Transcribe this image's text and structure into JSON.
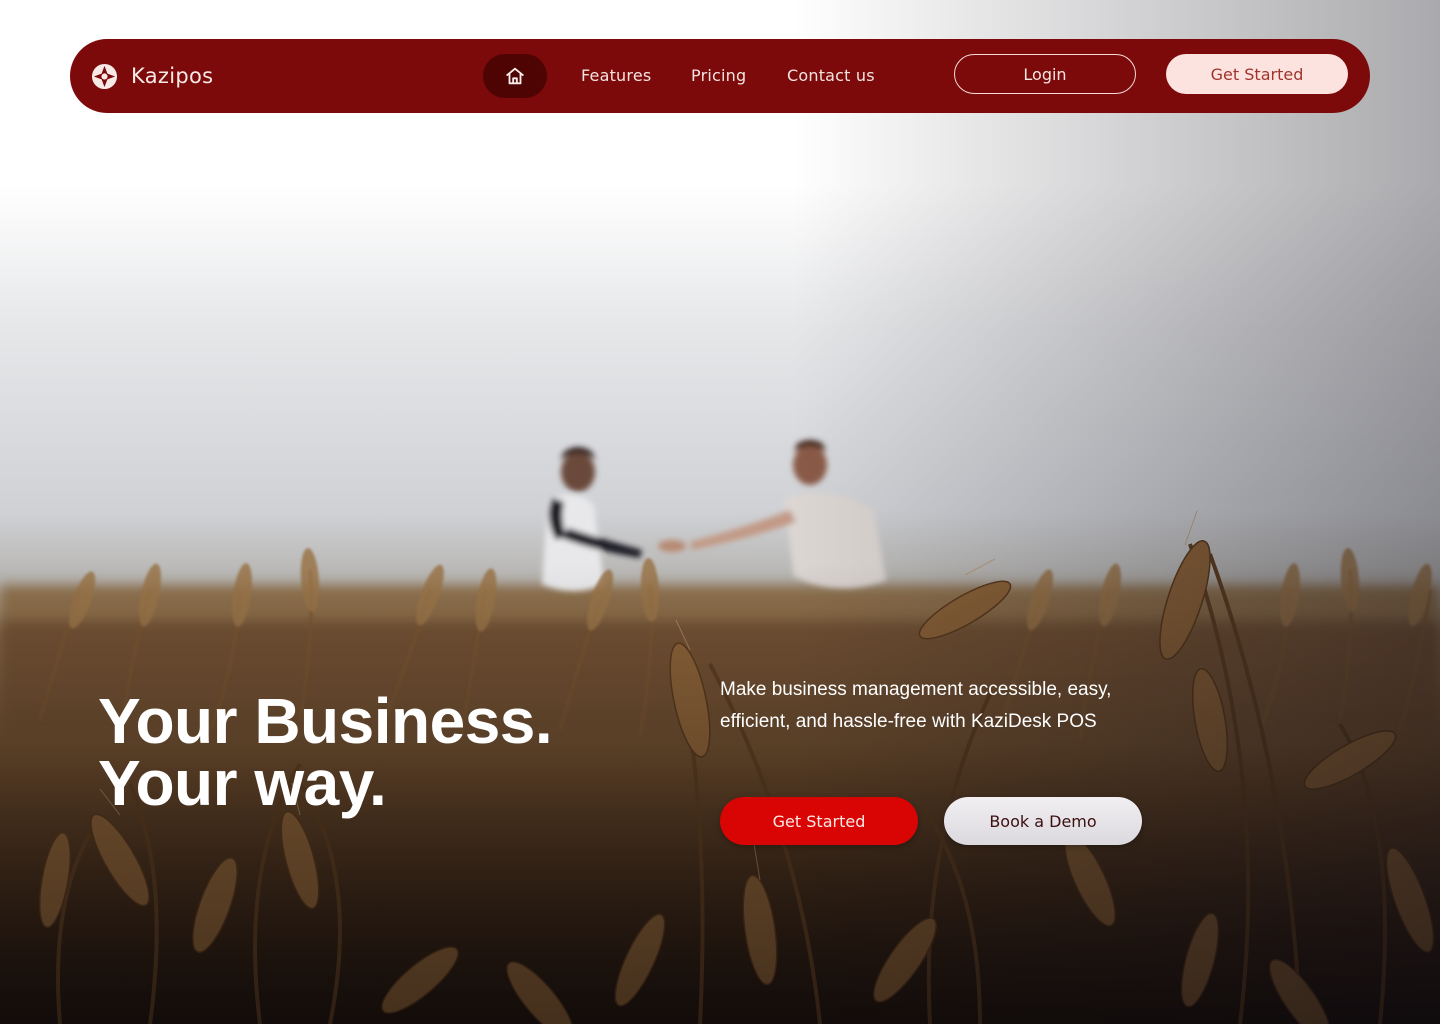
{
  "brand": {
    "name": "Kazipos",
    "icon": "compass-star-icon"
  },
  "nav": {
    "home_icon": "home-icon",
    "links": [
      "Features",
      "Pricing",
      "Contact us"
    ],
    "login_label": "Login",
    "get_started_label": "Get Started"
  },
  "hero": {
    "headline_line1": "Your Business.",
    "headline_line2": "Your way.",
    "subtext": "Make business management accessible, easy, efficient, and hassle-free with KaziDesk POS",
    "primary_cta": "Get Started",
    "secondary_cta": "Book a Demo",
    "image_description": "Two people shaking hands in a wheat field"
  },
  "colors": {
    "nav_bg": "#7d0a0a",
    "home_pill": "#4f0404",
    "nav_cta_bg": "#fde3df",
    "nav_cta_text": "#a2332c",
    "primary_cta": "#d90404",
    "secondary_cta": "#ebe9ed"
  }
}
